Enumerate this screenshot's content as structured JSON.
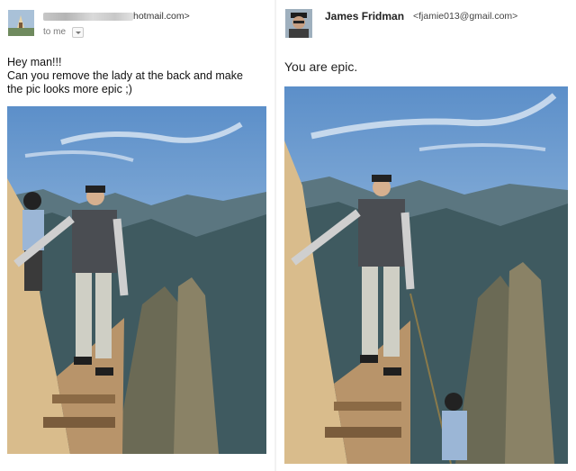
{
  "left": {
    "sender_domain": "hotmail.com>",
    "to_label": "to me",
    "message_lines": [
      "Hey man!!!",
      "Can you remove the lady at the back and make",
      "the pic looks more epic ;)"
    ]
  },
  "right": {
    "sender_name": "James Fridman",
    "sender_email": "<fjamie013@gmail.com>",
    "message": "You are epic."
  },
  "colors": {
    "sky_top": "#5c8fc9",
    "sky_bottom": "#c5dcef",
    "mountain": "#3f5a60",
    "cliff": "#d9bc8c"
  }
}
